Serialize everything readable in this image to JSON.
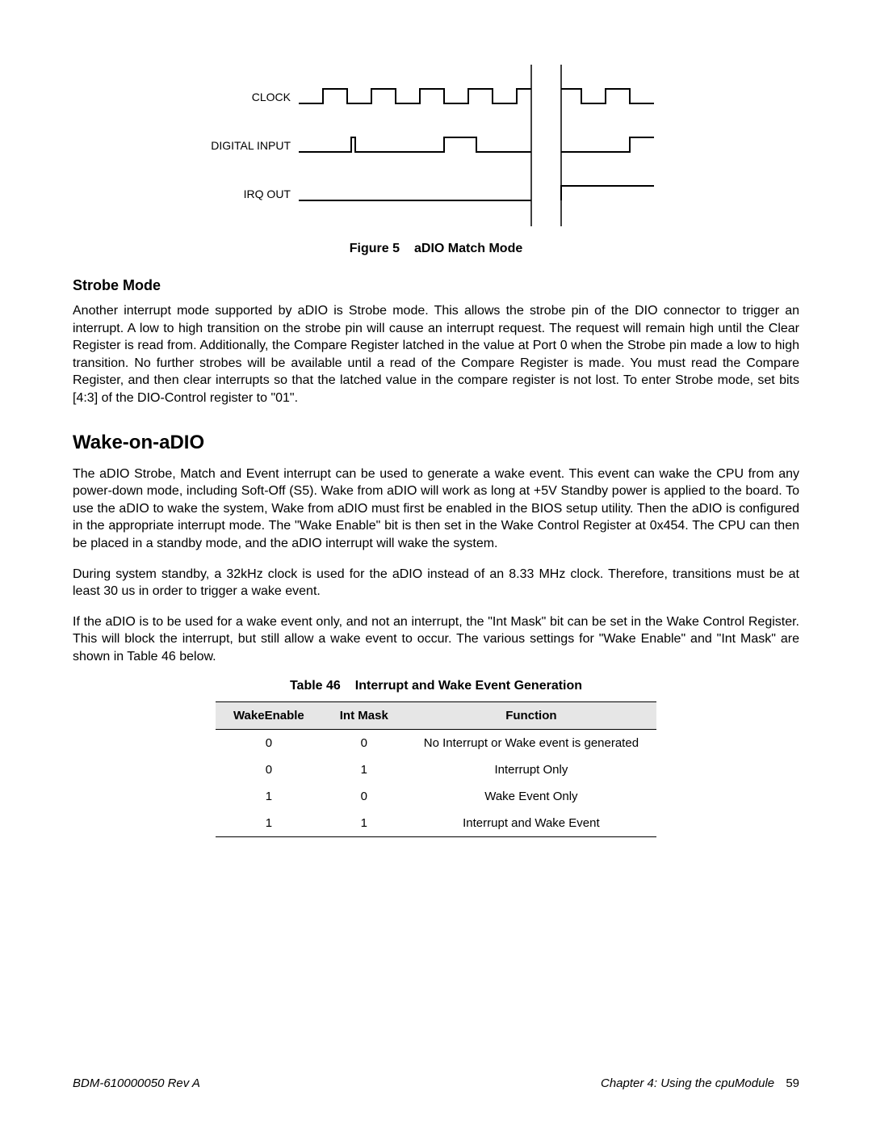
{
  "diagram": {
    "signals": [
      "CLOCK",
      "DIGITAL INPUT",
      "IRQ OUT"
    ]
  },
  "figure": {
    "label": "Figure 5",
    "title": "aDIO Match Mode"
  },
  "strobe": {
    "heading": "Strobe Mode",
    "para": "Another interrupt mode supported by aDIO is Strobe mode. This allows the strobe pin of the DIO connector to trigger an interrupt. A low to high transition on the strobe pin will cause an interrupt request. The request will remain high until the Clear Register is read from. Additionally, the Compare Register latched in the value at Port 0 when the Strobe pin made a low to high transition. No further strobes will be available until a read of the Compare Register is made. You must read the Compare Register, and then clear interrupts so that the latched value in the compare register is not lost. To enter Strobe mode, set bits [4:3] of the DIO-Control register to \"01\"."
  },
  "wake": {
    "heading": "Wake-on-aDIO",
    "p1": "The aDIO Strobe, Match and Event interrupt can be used to generate a wake event. This event can wake the CPU from any power-down mode, including Soft-Off (S5). Wake from aDIO will work as long at +5V Standby power is applied to the board. To use the aDIO to wake the system, Wake from aDIO must first be enabled in the BIOS setup utility. Then the aDIO is configured in the appropriate interrupt mode. The \"Wake Enable\" bit is then set in the Wake Control Register at 0x454. The CPU can then be placed in a standby mode, and the aDIO interrupt will wake the system.",
    "p2": "During system standby, a 32kHz clock is used for the aDIO instead of an 8.33 MHz clock. Therefore, transitions must be at least 30 us in order to trigger a wake event.",
    "p3": "If the aDIO is to be used for a wake event only, and not an interrupt, the \"Int Mask\" bit can be set in the Wake Control Register. This will block the interrupt, but still allow a wake event to occur. The various settings for \"Wake Enable\" and \"Int Mask\" are shown in Table 46 below."
  },
  "table": {
    "label": "Table 46",
    "title": "Interrupt and Wake Event Generation",
    "headers": [
      "WakeEnable",
      "Int Mask",
      "Function"
    ],
    "rows": [
      {
        "c0": "0",
        "c1": "0",
        "c2": "No Interrupt or Wake event is generated"
      },
      {
        "c0": "0",
        "c1": "1",
        "c2": "Interrupt Only"
      },
      {
        "c0": "1",
        "c1": "0",
        "c2": "Wake Event Only"
      },
      {
        "c0": "1",
        "c1": "1",
        "c2": "Interrupt and Wake Event"
      }
    ]
  },
  "footer": {
    "left": "BDM-610000050    Rev A",
    "right_chapter": "Chapter 4:  Using the cpuModule",
    "right_page": "59"
  }
}
